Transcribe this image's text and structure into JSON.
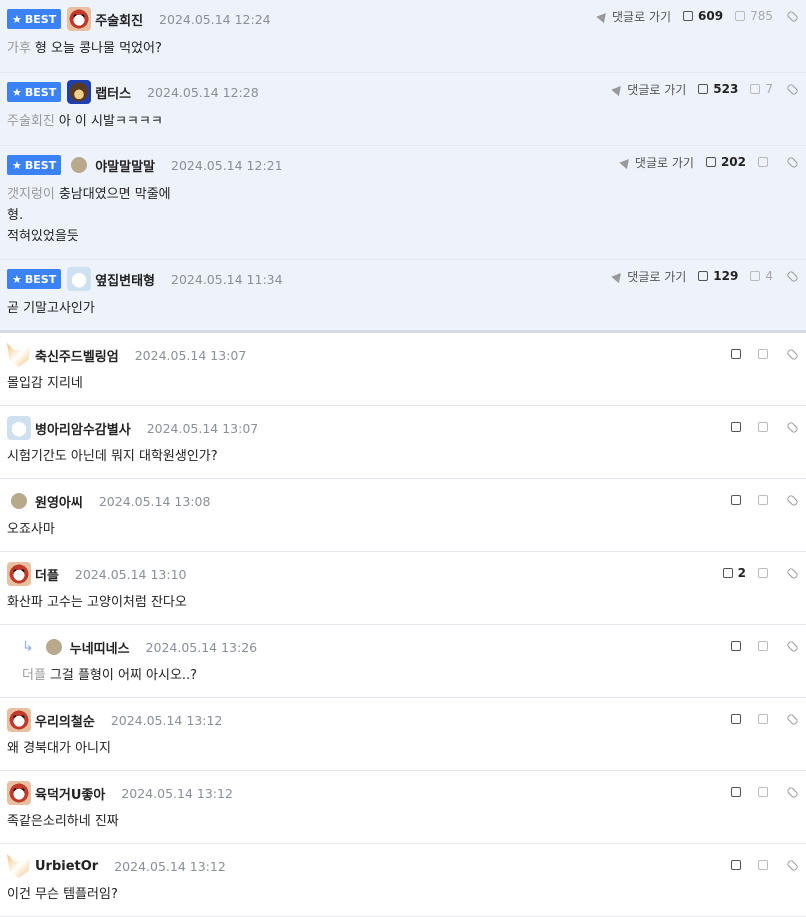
{
  "best_label": "BEST",
  "goto_label": "댓글로 가기",
  "best": [
    {
      "nick": "주술회진",
      "date": "2024.05.14 12:24",
      "mention": "가후",
      "lines": [
        "형 오늘 콩나물 먹었어?"
      ],
      "up": "609",
      "down": "785",
      "avatar": "dog"
    },
    {
      "nick": "랩터스",
      "date": "2024.05.14 12:28",
      "mention": "주술회진",
      "lines": [
        "아 이 시발ㅋㅋㅋㅋ"
      ],
      "up": "523",
      "down": "7",
      "avatar": "bear"
    },
    {
      "nick": "야말말말말",
      "date": "2024.05.14 12:21",
      "mention": "갯지렁이",
      "lines": [
        "충남대였으면 막줄에",
        "형.",
        "적혀있었을듯"
      ],
      "up": "202",
      "down": "",
      "avatar": "dot"
    },
    {
      "nick": "옆집변태형",
      "date": "2024.05.14 11:34",
      "mention": "",
      "lines": [
        "곧 기말고사인가"
      ],
      "up": "129",
      "down": "4",
      "avatar": "cat"
    }
  ],
  "comments": [
    {
      "nick": "축신주드벨링엄",
      "date": "2024.05.14 13:07",
      "mention": "",
      "text": "몰입감 지리네",
      "up": "",
      "avatar": "fox",
      "reply": false
    },
    {
      "nick": "병아리암수감별사",
      "date": "2024.05.14 13:07",
      "mention": "",
      "text": "시험기간도 아닌데 뭐지 대학원생인가?",
      "up": "",
      "avatar": "cat",
      "reply": false
    },
    {
      "nick": "원영아씨",
      "date": "2024.05.14 13:08",
      "mention": "",
      "text": "오죠사마",
      "up": "",
      "avatar": "dot",
      "reply": false
    },
    {
      "nick": "더플",
      "date": "2024.05.14 13:10",
      "mention": "",
      "text": "화산파 고수는 고양이처럼 잔다오",
      "up": "2",
      "avatar": "dog",
      "reply": false
    },
    {
      "nick": "누네띠네스",
      "date": "2024.05.14 13:26",
      "mention": "더플",
      "text": "그걸 플형이 어찌 아시오..?",
      "up": "",
      "avatar": "dot",
      "reply": true
    },
    {
      "nick": "우리의철순",
      "date": "2024.05.14 13:12",
      "mention": "",
      "text": "왜 경북대가 아니지",
      "up": "",
      "avatar": "dog",
      "reply": false
    },
    {
      "nick": "육덕거U좋아",
      "date": "2024.05.14 13:12",
      "mention": "",
      "text": "족같은소리하네 진짜",
      "up": "",
      "avatar": "dog",
      "reply": false
    },
    {
      "nick": "UrbietOr",
      "date": "2024.05.14 13:12",
      "mention": "",
      "text": "이건 무슨 템플러임?",
      "up": "",
      "avatar": "fox",
      "reply": false
    }
  ]
}
